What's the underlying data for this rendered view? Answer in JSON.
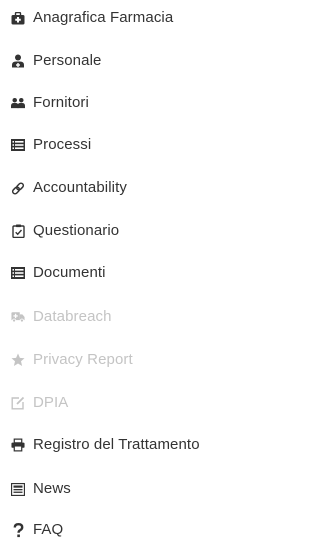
{
  "colors": {
    "text": "#333333",
    "icon": "#333333",
    "disabled": "#c4c4c4"
  },
  "menu": {
    "items": [
      {
        "label": "Anagrafica Farmacia",
        "icon": "medkit-icon",
        "enabled": true
      },
      {
        "label": "Personale",
        "icon": "user-md-icon",
        "enabled": true
      },
      {
        "label": "Fornitori",
        "icon": "users-icon",
        "enabled": true
      },
      {
        "label": "Processi",
        "icon": "list-icon",
        "enabled": true
      },
      {
        "label": "Accountability",
        "icon": "link-icon",
        "enabled": true
      },
      {
        "label": "Questionario",
        "icon": "clipboard-check-icon",
        "enabled": true
      },
      {
        "label": "Documenti",
        "icon": "list-icon",
        "enabled": true
      },
      {
        "label": "Databreach",
        "icon": "ambulance-icon",
        "enabled": false
      },
      {
        "label": "Privacy Report",
        "icon": "star-icon",
        "enabled": false
      },
      {
        "label": "DPIA",
        "icon": "edit-icon",
        "enabled": false
      },
      {
        "label": "Registro del Trattamento",
        "icon": "print-icon",
        "enabled": true
      },
      {
        "label": "News",
        "icon": "newspaper-icon",
        "enabled": true
      },
      {
        "label": "FAQ",
        "icon": "question-icon",
        "enabled": true
      }
    ]
  }
}
